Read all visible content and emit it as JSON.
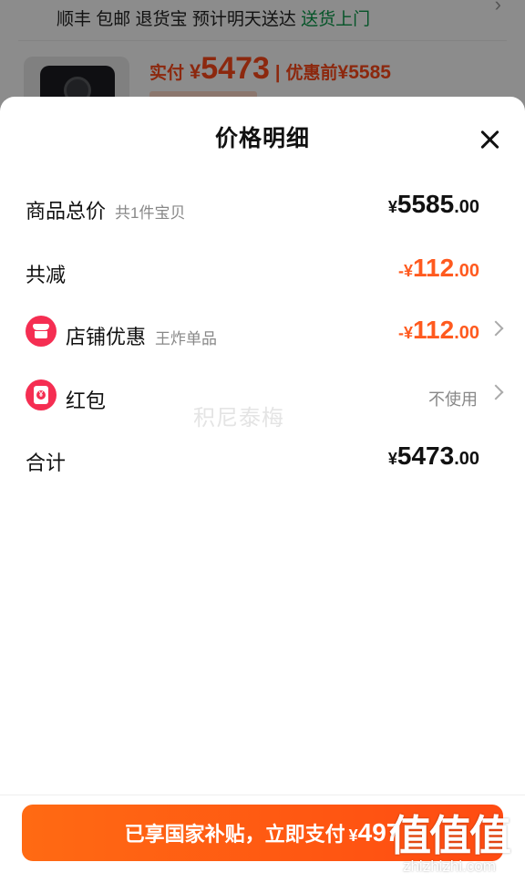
{
  "background": {
    "shipping_text": "顺丰 包邮 退货宝 预计明天送达",
    "shipping_highlight": "送货上门",
    "paid_label": "实付",
    "currency": "¥",
    "paid_amount": "5473",
    "original_label": "优惠前",
    "original_amount": "¥5585"
  },
  "sheet": {
    "title": "价格明细",
    "rows": {
      "total": {
        "label": "商品总价",
        "sub": "共1件宝贝",
        "yen": "¥",
        "int": "5585",
        "dec": ".00"
      },
      "discount": {
        "label": "共减",
        "yen": "-¥",
        "int": "112",
        "dec": ".00"
      },
      "store": {
        "label": "店铺优惠",
        "sub": "王炸单品",
        "yen": "-¥",
        "int": "112",
        "dec": ".00"
      },
      "redpacket": {
        "label": "红包",
        "status": "不使用"
      },
      "sum": {
        "label": "合计",
        "yen": "¥",
        "int": "5473",
        "dec": ".00"
      }
    },
    "watermark": "积尼泰梅"
  },
  "pay_button": {
    "label": "已享国家补贴，立即支付",
    "yen": "¥",
    "amount": "497"
  },
  "site_logo": {
    "big": "值值值",
    "small": "zhizhizhi.com"
  },
  "colors": {
    "accent_orange": "#ff5a1f",
    "icon_red": "#f52e52",
    "green": "#0a9a4a"
  }
}
